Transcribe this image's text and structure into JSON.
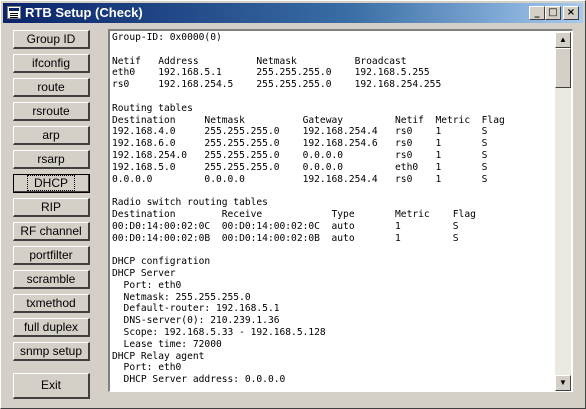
{
  "window": {
    "title": "RTB Setup (Check)"
  },
  "titlebar_buttons": {
    "minimize": "_",
    "maximize": "□",
    "close": "×"
  },
  "sidebar": {
    "items": [
      {
        "label": "Group ID"
      },
      {
        "label": "ifconfig"
      },
      {
        "label": "route"
      },
      {
        "label": "rsroute"
      },
      {
        "label": "arp"
      },
      {
        "label": "rsarp"
      },
      {
        "label": "DHCP"
      },
      {
        "label": "RIP"
      },
      {
        "label": "RF channel"
      },
      {
        "label": "portfilter"
      },
      {
        "label": "scramble"
      },
      {
        "label": "txmethod"
      },
      {
        "label": "full duplex"
      },
      {
        "label": "snmp setup"
      }
    ],
    "exit_label": "Exit"
  },
  "output": {
    "lines": [
      "Group-ID: 0x0000(0)",
      "",
      "Netif   Address          Netmask          Broadcast",
      "eth0    192.168.5.1      255.255.255.0    192.168.5.255",
      "rs0     192.168.254.5    255.255.255.0    192.168.254.255",
      "",
      "Routing tables",
      "Destination     Netmask          Gateway         Netif  Metric  Flag",
      "192.168.4.0     255.255.255.0    192.168.254.4   rs0    1       S",
      "192.168.6.0     255.255.255.0    192.168.254.6   rs0    1       S",
      "192.168.254.0   255.255.255.0    0.0.0.0         rs0    1       S",
      "192.168.5.0     255.255.255.0    0.0.0.0         eth0   1       S",
      "0.0.0.0         0.0.0.0          192.168.254.4   rs0    1       S",
      "",
      "Radio switch routing tables",
      "Destination        Receive            Type       Metric    Flag",
      "00:D0:14:00:02:0C  00:D0:14:00:02:0C  auto       1         S",
      "00:D0:14:00:02:0B  00:D0:14:00:02:0B  auto       1         S",
      "",
      "DHCP configration",
      "DHCP Server",
      "  Port: eth0",
      "  Netmask: 255.255.255.0",
      "  Default-router: 192.168.5.1",
      "  DNS-server(0): 210.239.1.36",
      "  Scope: 192.168.5.33 - 192.168.5.128",
      "  Lease time: 72000",
      "DHCP Relay agent",
      "  Port: eth0",
      "  DHCP Server address: 0.0.0.0"
    ]
  },
  "scrollbar": {
    "up_arrow": "▲",
    "down_arrow": "▼"
  }
}
